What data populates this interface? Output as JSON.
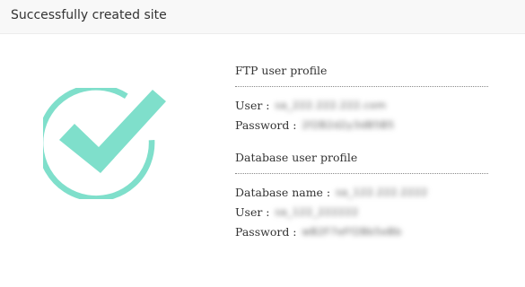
{
  "dialog": {
    "title": "Successfully created site"
  },
  "success_graphic": {
    "icon": "check-circle-icon",
    "color": "#7fdfcb"
  },
  "ftp_profile": {
    "title": "FTP user profile",
    "user_label": "User :",
    "user_value": "sa_222.222.222.com",
    "password_label": "Password :",
    "password_value": "2f2B2d2y3dB5B5"
  },
  "database_profile": {
    "title": "Database user profile",
    "name_label": "Database name :",
    "name_value": "sa_122.222.2222",
    "user_label": "User :",
    "user_value": "sa_122_222222",
    "password_label": "Password :",
    "password_value": "wB2F7eFf2Bb5eBb"
  }
}
